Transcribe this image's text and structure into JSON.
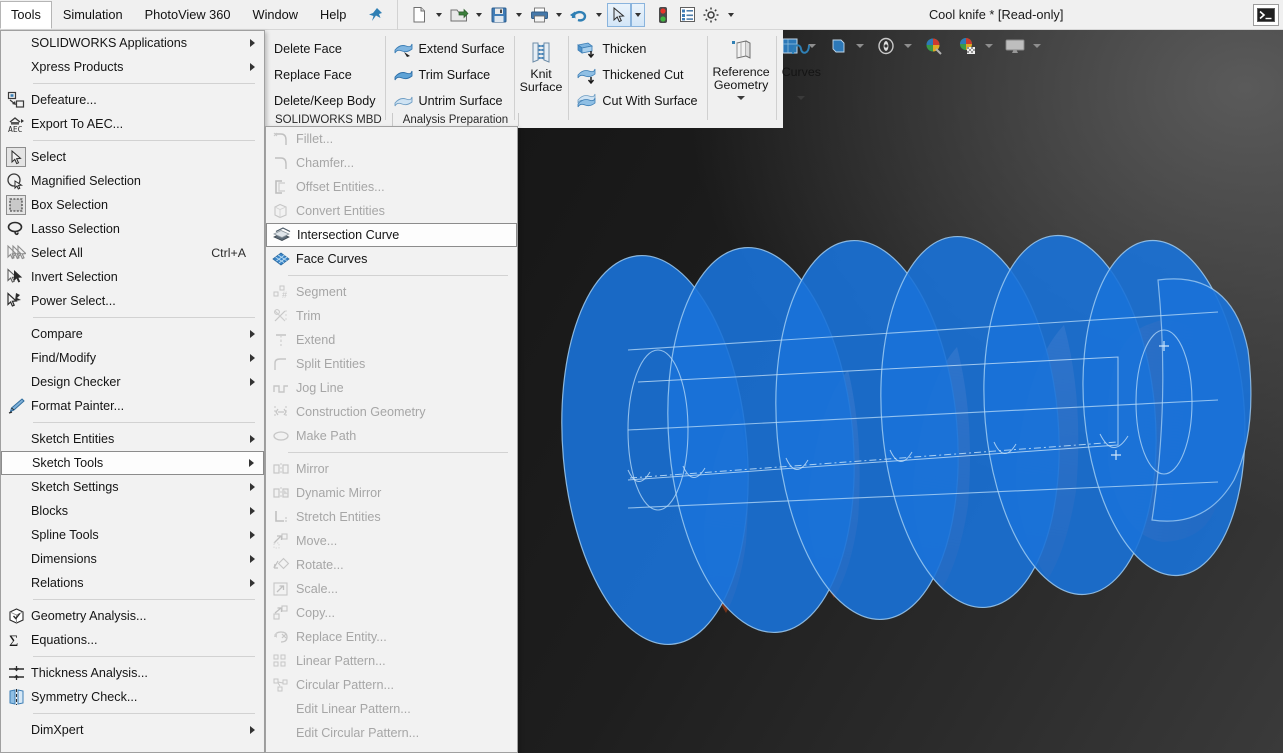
{
  "window": {
    "document_title": "Cool knife * [Read-only]",
    "system_corner_icon": "console-icon"
  },
  "menubar": {
    "items": [
      {
        "label": "Tools",
        "active": true
      },
      {
        "label": "Simulation",
        "active": false
      },
      {
        "label": "PhotoView 360",
        "active": false
      },
      {
        "label": "Window",
        "active": false
      },
      {
        "label": "Help",
        "active": false
      }
    ],
    "pin_icon": "pushpin-icon"
  },
  "quick_access": {
    "buttons": [
      {
        "name": "new-document-icon",
        "has_caret": true
      },
      {
        "name": "open-folder-icon",
        "has_caret": true
      },
      {
        "name": "save-icon",
        "has_caret": true
      },
      {
        "name": "print-icon",
        "has_caret": true
      },
      {
        "name": "undo-icon",
        "has_caret": true
      },
      {
        "name": "select-cursor-icon",
        "has_caret": true,
        "boxed": true
      },
      {
        "name": "rebuild-traffic-light-icon",
        "has_caret": false
      },
      {
        "name": "options-list-icon",
        "has_caret": false
      },
      {
        "name": "settings-gear-icon",
        "has_caret": true
      }
    ]
  },
  "ribbon": {
    "groups": [
      {
        "name": "face-body-group",
        "type": "text-rows",
        "rows": [
          {
            "label": "Delete Face",
            "icon": "delete-face-icon"
          },
          {
            "label": "Replace Face",
            "icon": "replace-face-icon"
          },
          {
            "label": "Delete/Keep Body",
            "icon": "delete-keep-body-icon"
          }
        ]
      },
      {
        "name": "surface-group",
        "type": "icon-rows",
        "rows": [
          {
            "label": "Extend Surface",
            "icon": "extend-surface-icon"
          },
          {
            "label": "Trim Surface",
            "icon": "trim-surface-icon"
          },
          {
            "label": "Untrim Surface",
            "icon": "untrim-surface-icon"
          }
        ]
      },
      {
        "name": "knit-surface-group",
        "type": "big",
        "label_line1": "Knit",
        "label_line2": "Surface",
        "icon": "knit-surface-icon"
      },
      {
        "name": "thicken-group",
        "type": "icon-rows",
        "rows": [
          {
            "label": "Thicken",
            "icon": "thicken-icon"
          },
          {
            "label": "Thickened Cut",
            "icon": "thickened-cut-icon"
          },
          {
            "label": "Cut With Surface",
            "icon": "cut-with-surface-icon"
          }
        ]
      },
      {
        "name": "reference-geometry-group",
        "type": "big-dropdown",
        "label_line1": "Reference",
        "label_line2": "Geometry",
        "icon": "reference-geometry-icon",
        "has_caret": true
      },
      {
        "name": "curves-group",
        "type": "big-dropdown",
        "label_line1": "Curves",
        "label_line2": "",
        "icon": "curves-icon",
        "has_caret": true
      }
    ]
  },
  "command_tabs": [
    {
      "label": "SOLIDWORKS MBD"
    },
    {
      "label": "Analysis Preparation"
    }
  ],
  "tools_menu": {
    "items": [
      {
        "label": "SOLIDWORKS Applications",
        "icon": null,
        "submenu": true,
        "disabled": false
      },
      {
        "label": "Xpress Products",
        "icon": null,
        "submenu": true,
        "disabled": false
      },
      {
        "separator": true
      },
      {
        "label": "Defeature...",
        "icon": "defeature-icon",
        "submenu": false,
        "disabled": false
      },
      {
        "label": "Export To AEC...",
        "icon": "export-aec-icon",
        "submenu": false,
        "disabled": false
      },
      {
        "separator": true
      },
      {
        "label": "Select",
        "icon": "select-arrow-icon",
        "submenu": false,
        "disabled": false,
        "icon_boxed": true
      },
      {
        "label": "Magnified Selection",
        "icon": "magnified-selection-icon",
        "submenu": false,
        "disabled": false
      },
      {
        "label": "Box Selection",
        "icon": "box-selection-icon",
        "submenu": false,
        "disabled": false,
        "icon_boxed": true
      },
      {
        "label": "Lasso Selection",
        "icon": "lasso-selection-icon",
        "submenu": false,
        "disabled": false
      },
      {
        "label": "Select All",
        "icon": "select-all-icon",
        "submenu": false,
        "disabled": false,
        "accel": "Ctrl+A"
      },
      {
        "label": "Invert Selection",
        "icon": "invert-selection-icon",
        "submenu": false,
        "disabled": false
      },
      {
        "label": "Power Select...",
        "icon": "power-select-icon",
        "submenu": false,
        "disabled": false
      },
      {
        "separator": true
      },
      {
        "label": "Compare",
        "icon": null,
        "submenu": true,
        "disabled": false
      },
      {
        "label": "Find/Modify",
        "icon": null,
        "submenu": true,
        "disabled": false
      },
      {
        "label": "Design Checker",
        "icon": null,
        "submenu": true,
        "disabled": false
      },
      {
        "label": "Format Painter...",
        "icon": "format-painter-icon",
        "submenu": false,
        "disabled": false
      },
      {
        "separator": true
      },
      {
        "label": "Sketch Entities",
        "icon": null,
        "submenu": true,
        "disabled": false
      },
      {
        "label": "Sketch Tools",
        "icon": null,
        "submenu": true,
        "disabled": false,
        "highlighted": true
      },
      {
        "label": "Sketch Settings",
        "icon": null,
        "submenu": true,
        "disabled": false
      },
      {
        "label": "Blocks",
        "icon": null,
        "submenu": true,
        "disabled": false
      },
      {
        "label": "Spline Tools",
        "icon": null,
        "submenu": true,
        "disabled": false
      },
      {
        "label": "Dimensions",
        "icon": null,
        "submenu": true,
        "disabled": false
      },
      {
        "label": "Relations",
        "icon": null,
        "submenu": true,
        "disabled": false
      },
      {
        "separator": true
      },
      {
        "label": "Geometry Analysis...",
        "icon": "geometry-analysis-icon",
        "submenu": false,
        "disabled": false
      },
      {
        "label": "Equations...",
        "icon": "equations-sigma-icon",
        "submenu": false,
        "disabled": false
      },
      {
        "separator": true
      },
      {
        "label": "Thickness Analysis...",
        "icon": "thickness-analysis-icon",
        "submenu": false,
        "disabled": false
      },
      {
        "label": "Symmetry Check...",
        "icon": "symmetry-check-icon",
        "submenu": false,
        "disabled": false
      },
      {
        "separator": true
      },
      {
        "label": "DimXpert",
        "icon": null,
        "submenu": true,
        "disabled": false
      }
    ]
  },
  "sketch_tools_submenu": {
    "items": [
      {
        "label": "Fillet...",
        "icon": "sketch-fillet-icon",
        "disabled": true
      },
      {
        "label": "Chamfer...",
        "icon": "sketch-chamfer-icon",
        "disabled": true
      },
      {
        "label": "Offset Entities...",
        "icon": "offset-entities-icon",
        "disabled": true
      },
      {
        "label": "Convert Entities",
        "icon": "convert-entities-icon",
        "disabled": true
      },
      {
        "label": "Intersection Curve",
        "icon": "intersection-curve-icon",
        "disabled": false,
        "highlighted": true
      },
      {
        "label": "Face Curves",
        "icon": "face-curves-icon",
        "disabled": false
      },
      {
        "separator": true
      },
      {
        "label": "Segment",
        "icon": "segment-icon",
        "disabled": true
      },
      {
        "label": "Trim",
        "icon": "trim-icon",
        "disabled": true
      },
      {
        "label": "Extend",
        "icon": "extend-icon",
        "disabled": true
      },
      {
        "label": "Split Entities",
        "icon": "split-entities-icon",
        "disabled": true
      },
      {
        "label": "Jog Line",
        "icon": "jog-line-icon",
        "disabled": true
      },
      {
        "label": "Construction Geometry",
        "icon": "construction-geometry-icon",
        "disabled": true
      },
      {
        "label": "Make Path",
        "icon": "make-path-icon",
        "disabled": true
      },
      {
        "separator": true
      },
      {
        "label": "Mirror",
        "icon": "mirror-icon",
        "disabled": true
      },
      {
        "label": "Dynamic Mirror",
        "icon": "dynamic-mirror-icon",
        "disabled": true
      },
      {
        "label": "Stretch Entities",
        "icon": "stretch-entities-icon",
        "disabled": true
      },
      {
        "label": "Move...",
        "icon": "move-icon",
        "disabled": true
      },
      {
        "label": "Rotate...",
        "icon": "rotate-icon",
        "disabled": true
      },
      {
        "label": "Scale...",
        "icon": "scale-icon",
        "disabled": true
      },
      {
        "label": "Copy...",
        "icon": "copy-icon",
        "disabled": true
      },
      {
        "label": "Replace Entity...",
        "icon": "replace-entity-icon",
        "disabled": true
      },
      {
        "label": "Linear Pattern...",
        "icon": "linear-pattern-icon",
        "disabled": true
      },
      {
        "label": "Circular Pattern...",
        "icon": "circular-pattern-icon",
        "disabled": true
      },
      {
        "label": "Edit Linear Pattern...",
        "icon": null,
        "disabled": true
      },
      {
        "label": "Edit Circular Pattern...",
        "icon": null,
        "disabled": true
      }
    ]
  },
  "viewport": {
    "toolbar_icons": [
      {
        "name": "zoom-to-fit-icon",
        "caret": false
      },
      {
        "name": "zoom-to-area-icon",
        "caret": false
      },
      {
        "name": "pan-zoom-icon",
        "caret": false
      },
      {
        "name": "previous-view-icon",
        "caret": false
      },
      {
        "name": "section-view-icon",
        "caret": false
      },
      {
        "name": "view-orientation-icon",
        "caret": false
      },
      {
        "name": "display-style-icon",
        "caret": false
      },
      {
        "name": "view-settings-cube-icon",
        "caret": true
      },
      {
        "name": "hide-show-items-icon",
        "caret": true
      },
      {
        "name": "edit-appearance-icon",
        "caret": false
      },
      {
        "name": "apply-scene-icon",
        "caret": true
      },
      {
        "name": "view-setting-screen-icon",
        "caret": true
      }
    ],
    "model": {
      "name": "helical-sweep-model",
      "surface_color": "#1a72d8",
      "edge_color": "#a9d2f5",
      "solid_color": "#b9522a",
      "background_dark": "#161616",
      "background_light": "#4a4a4a"
    }
  }
}
